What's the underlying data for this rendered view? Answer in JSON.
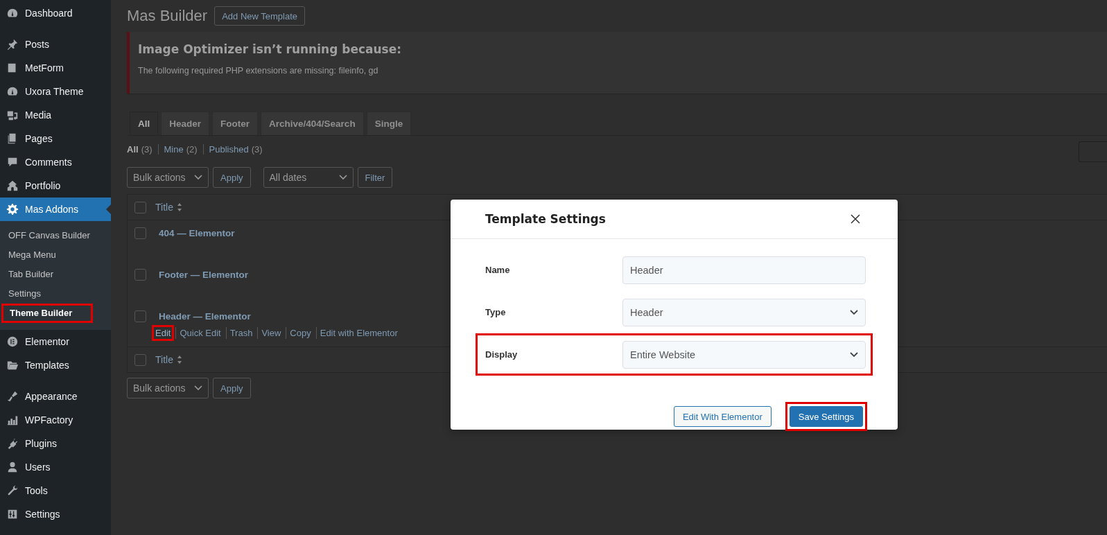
{
  "sidebar": {
    "groups": [
      [
        {
          "label": "Dashboard",
          "selected": false
        }
      ],
      [
        {
          "label": "Posts",
          "selected": false
        },
        {
          "label": "MetForm",
          "selected": false
        },
        {
          "label": "Uxora Theme",
          "selected": false
        },
        {
          "label": "Media",
          "selected": false
        },
        {
          "label": "Pages",
          "selected": false
        },
        {
          "label": "Comments",
          "selected": false
        },
        {
          "label": "Portfolio",
          "selected": false
        },
        {
          "label": "Mas Addons",
          "selected": true,
          "children": [
            {
              "label": "OFF Canvas Builder",
              "selected": false,
              "highlighted": false
            },
            {
              "label": "Mega Menu",
              "selected": false,
              "highlighted": false
            },
            {
              "label": "Tab Builder",
              "selected": false,
              "highlighted": false
            },
            {
              "label": "Settings",
              "selected": false,
              "highlighted": false
            },
            {
              "label": "Theme Builder",
              "selected": true,
              "highlighted": true
            }
          ]
        },
        {
          "label": "Elementor",
          "selected": false
        },
        {
          "label": "Templates",
          "selected": false
        }
      ],
      [
        {
          "label": "Appearance",
          "selected": false
        },
        {
          "label": "WPFactory",
          "selected": false
        },
        {
          "label": "Plugins",
          "selected": false
        },
        {
          "label": "Users",
          "selected": false
        },
        {
          "label": "Tools",
          "selected": false
        },
        {
          "label": "Settings",
          "selected": false
        }
      ]
    ]
  },
  "page": {
    "title": "Mas Builder",
    "add_button": "Add New Template",
    "notice": {
      "title": "Image Optimizer isn’t running because:",
      "message": "The following required PHP extensions are missing: fileinfo, gd"
    },
    "tabs": [
      {
        "label": "All",
        "selected": true
      },
      {
        "label": "Header",
        "selected": false
      },
      {
        "label": "Footer",
        "selected": false
      },
      {
        "label": "Archive/404/Search",
        "selected": false
      },
      {
        "label": "Single",
        "selected": false
      }
    ],
    "filters": [
      {
        "label": "All",
        "count": "(3)",
        "selected": true
      },
      {
        "label": "Mine",
        "count": "(2)",
        "selected": false
      },
      {
        "label": "Published",
        "count": "(3)",
        "selected": false
      }
    ],
    "bulk_actions": "Bulk actions",
    "apply": "Apply",
    "dates": "All dates",
    "filter": "Filter",
    "table": {
      "column_title": "Title",
      "header_checked": false,
      "rows": [
        {
          "title": "404 — Elementor",
          "checked": false
        },
        {
          "title": "Footer — Elementor",
          "checked": false
        },
        {
          "title": "Header — Elementor",
          "checked": false,
          "actions": [
            {
              "label": "Edit",
              "highlighted": true
            },
            {
              "label": "Quick Edit",
              "highlighted": false
            },
            {
              "label": "Trash",
              "highlighted": false
            },
            {
              "label": "View",
              "highlighted": false
            },
            {
              "label": "Copy",
              "highlighted": false
            },
            {
              "label": "Edit with Elementor",
              "highlighted": false
            }
          ]
        }
      ],
      "footer_title": "Title",
      "footer_checked": false
    },
    "bottom_bulk_actions": "Bulk actions",
    "bottom_apply": "Apply"
  },
  "modal": {
    "title": "Template Settings",
    "fields": [
      {
        "label": "Name",
        "kind": "text",
        "value": "Header",
        "highlighted": false
      },
      {
        "label": "Type",
        "kind": "select",
        "value": "Header",
        "highlighted": false
      },
      {
        "label": "Display",
        "kind": "select",
        "value": "Entire Website",
        "highlighted": true
      }
    ],
    "buttons": [
      {
        "label": "Edit With Elementor",
        "kind": "secondary",
        "highlighted": false
      },
      {
        "label": "Save Settings",
        "kind": "primary",
        "highlighted": true
      }
    ]
  }
}
